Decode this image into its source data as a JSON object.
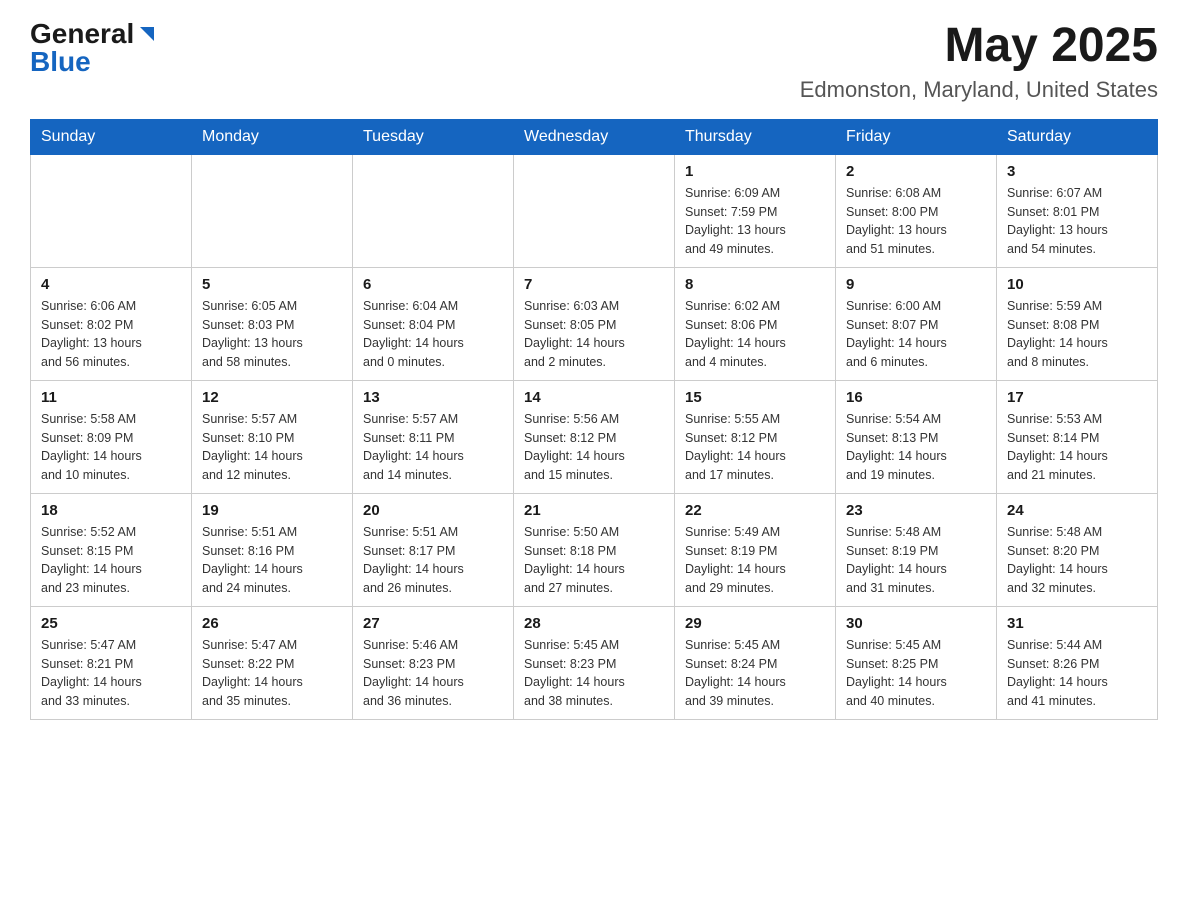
{
  "header": {
    "logo_general": "General",
    "logo_blue": "Blue",
    "month": "May 2025",
    "location": "Edmonston, Maryland, United States"
  },
  "weekdays": [
    "Sunday",
    "Monday",
    "Tuesday",
    "Wednesday",
    "Thursday",
    "Friday",
    "Saturday"
  ],
  "weeks": [
    [
      {
        "day": "",
        "info": ""
      },
      {
        "day": "",
        "info": ""
      },
      {
        "day": "",
        "info": ""
      },
      {
        "day": "",
        "info": ""
      },
      {
        "day": "1",
        "info": "Sunrise: 6:09 AM\nSunset: 7:59 PM\nDaylight: 13 hours\nand 49 minutes."
      },
      {
        "day": "2",
        "info": "Sunrise: 6:08 AM\nSunset: 8:00 PM\nDaylight: 13 hours\nand 51 minutes."
      },
      {
        "day": "3",
        "info": "Sunrise: 6:07 AM\nSunset: 8:01 PM\nDaylight: 13 hours\nand 54 minutes."
      }
    ],
    [
      {
        "day": "4",
        "info": "Sunrise: 6:06 AM\nSunset: 8:02 PM\nDaylight: 13 hours\nand 56 minutes."
      },
      {
        "day": "5",
        "info": "Sunrise: 6:05 AM\nSunset: 8:03 PM\nDaylight: 13 hours\nand 58 minutes."
      },
      {
        "day": "6",
        "info": "Sunrise: 6:04 AM\nSunset: 8:04 PM\nDaylight: 14 hours\nand 0 minutes."
      },
      {
        "day": "7",
        "info": "Sunrise: 6:03 AM\nSunset: 8:05 PM\nDaylight: 14 hours\nand 2 minutes."
      },
      {
        "day": "8",
        "info": "Sunrise: 6:02 AM\nSunset: 8:06 PM\nDaylight: 14 hours\nand 4 minutes."
      },
      {
        "day": "9",
        "info": "Sunrise: 6:00 AM\nSunset: 8:07 PM\nDaylight: 14 hours\nand 6 minutes."
      },
      {
        "day": "10",
        "info": "Sunrise: 5:59 AM\nSunset: 8:08 PM\nDaylight: 14 hours\nand 8 minutes."
      }
    ],
    [
      {
        "day": "11",
        "info": "Sunrise: 5:58 AM\nSunset: 8:09 PM\nDaylight: 14 hours\nand 10 minutes."
      },
      {
        "day": "12",
        "info": "Sunrise: 5:57 AM\nSunset: 8:10 PM\nDaylight: 14 hours\nand 12 minutes."
      },
      {
        "day": "13",
        "info": "Sunrise: 5:57 AM\nSunset: 8:11 PM\nDaylight: 14 hours\nand 14 minutes."
      },
      {
        "day": "14",
        "info": "Sunrise: 5:56 AM\nSunset: 8:12 PM\nDaylight: 14 hours\nand 15 minutes."
      },
      {
        "day": "15",
        "info": "Sunrise: 5:55 AM\nSunset: 8:12 PM\nDaylight: 14 hours\nand 17 minutes."
      },
      {
        "day": "16",
        "info": "Sunrise: 5:54 AM\nSunset: 8:13 PM\nDaylight: 14 hours\nand 19 minutes."
      },
      {
        "day": "17",
        "info": "Sunrise: 5:53 AM\nSunset: 8:14 PM\nDaylight: 14 hours\nand 21 minutes."
      }
    ],
    [
      {
        "day": "18",
        "info": "Sunrise: 5:52 AM\nSunset: 8:15 PM\nDaylight: 14 hours\nand 23 minutes."
      },
      {
        "day": "19",
        "info": "Sunrise: 5:51 AM\nSunset: 8:16 PM\nDaylight: 14 hours\nand 24 minutes."
      },
      {
        "day": "20",
        "info": "Sunrise: 5:51 AM\nSunset: 8:17 PM\nDaylight: 14 hours\nand 26 minutes."
      },
      {
        "day": "21",
        "info": "Sunrise: 5:50 AM\nSunset: 8:18 PM\nDaylight: 14 hours\nand 27 minutes."
      },
      {
        "day": "22",
        "info": "Sunrise: 5:49 AM\nSunset: 8:19 PM\nDaylight: 14 hours\nand 29 minutes."
      },
      {
        "day": "23",
        "info": "Sunrise: 5:48 AM\nSunset: 8:19 PM\nDaylight: 14 hours\nand 31 minutes."
      },
      {
        "day": "24",
        "info": "Sunrise: 5:48 AM\nSunset: 8:20 PM\nDaylight: 14 hours\nand 32 minutes."
      }
    ],
    [
      {
        "day": "25",
        "info": "Sunrise: 5:47 AM\nSunset: 8:21 PM\nDaylight: 14 hours\nand 33 minutes."
      },
      {
        "day": "26",
        "info": "Sunrise: 5:47 AM\nSunset: 8:22 PM\nDaylight: 14 hours\nand 35 minutes."
      },
      {
        "day": "27",
        "info": "Sunrise: 5:46 AM\nSunset: 8:23 PM\nDaylight: 14 hours\nand 36 minutes."
      },
      {
        "day": "28",
        "info": "Sunrise: 5:45 AM\nSunset: 8:23 PM\nDaylight: 14 hours\nand 38 minutes."
      },
      {
        "day": "29",
        "info": "Sunrise: 5:45 AM\nSunset: 8:24 PM\nDaylight: 14 hours\nand 39 minutes."
      },
      {
        "day": "30",
        "info": "Sunrise: 5:45 AM\nSunset: 8:25 PM\nDaylight: 14 hours\nand 40 minutes."
      },
      {
        "day": "31",
        "info": "Sunrise: 5:44 AM\nSunset: 8:26 PM\nDaylight: 14 hours\nand 41 minutes."
      }
    ]
  ]
}
